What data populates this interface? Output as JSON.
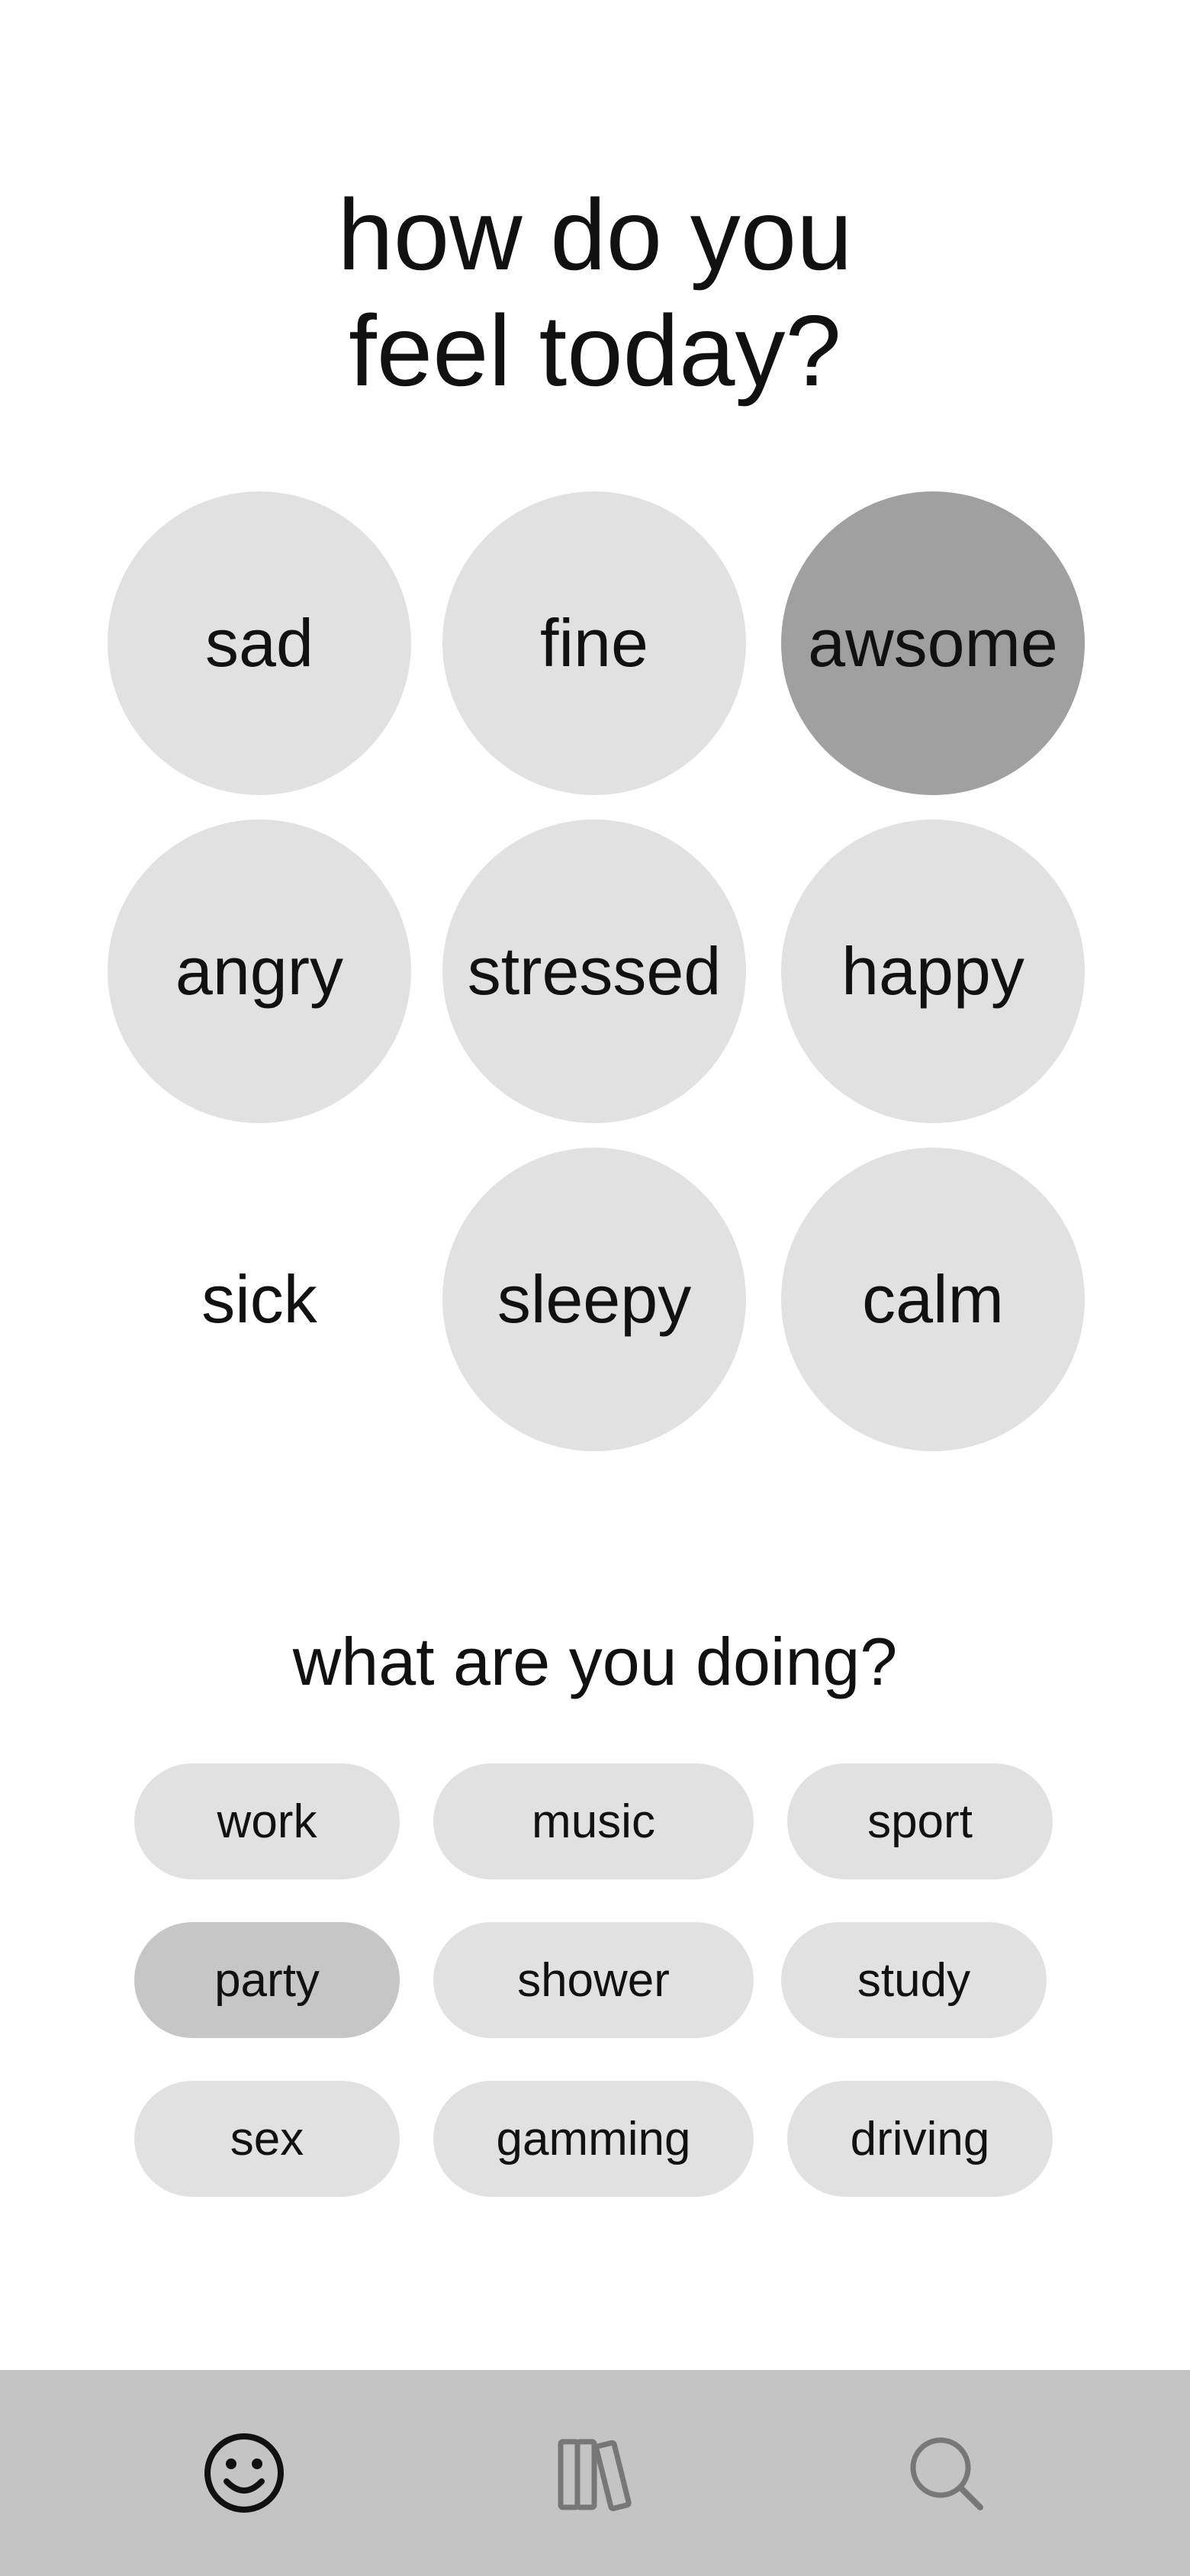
{
  "header": {
    "title_line1": "how do you",
    "title_line2": "feel today?"
  },
  "moods": [
    {
      "label": "sad",
      "selected": false
    },
    {
      "label": "fine",
      "selected": false
    },
    {
      "label": "awsome",
      "selected": true
    },
    {
      "label": "angry",
      "selected": false
    },
    {
      "label": "stressed",
      "selected": false
    },
    {
      "label": "happy",
      "selected": false
    },
    {
      "label": "sick",
      "selected": false
    },
    {
      "label": "sleepy",
      "selected": false
    },
    {
      "label": "calm",
      "selected": false
    }
  ],
  "activities": {
    "title": "what are you doing?",
    "items": [
      {
        "label": "work",
        "selected": false
      },
      {
        "label": "music",
        "selected": false
      },
      {
        "label": "sport",
        "selected": false
      },
      {
        "label": "party",
        "selected": true
      },
      {
        "label": "shower",
        "selected": false
      },
      {
        "label": "study",
        "selected": false
      },
      {
        "label": "sex",
        "selected": false
      },
      {
        "label": "gamming",
        "selected": false
      },
      {
        "label": "driving",
        "selected": false
      }
    ]
  },
  "nav": {
    "items": [
      {
        "icon": "smiley-face-icon",
        "active": true
      },
      {
        "icon": "library-books-icon",
        "active": false
      },
      {
        "icon": "search-icon",
        "active": false
      }
    ]
  },
  "colors": {
    "background": "#ffffff",
    "bubble": "#e1e1e1",
    "bubble_selected": "#a0a0a0",
    "chip_selected": "#c6c6c6",
    "nav_background": "#c4c4c4",
    "icon_active": "#111111",
    "icon_inactive": "#777777"
  }
}
